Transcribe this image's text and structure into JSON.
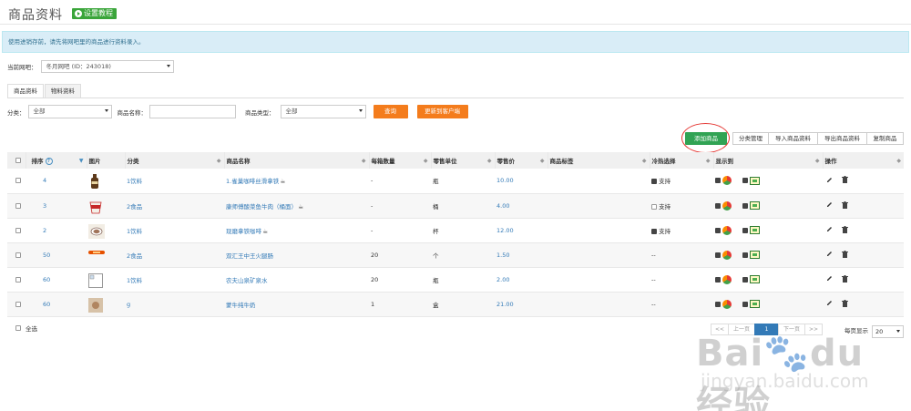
{
  "header": {
    "title": "商品资料",
    "tutorial_label": "设置教程"
  },
  "notice": "使用进销存前，请先将网吧里的商品进行资料录入。",
  "shop": {
    "label": "当前网吧：",
    "value": "冬月网吧 (ID：243018)"
  },
  "tabs": [
    {
      "label": "商品资料",
      "active": true
    },
    {
      "label": "物料资料",
      "active": false
    }
  ],
  "filters": {
    "category_label": "分类：",
    "category_value": "全部",
    "name_label": "商品名称：",
    "name_value": "",
    "type_label": "商品类型：",
    "type_value": "全部",
    "query_label": "查询",
    "sync_label": "更新到客户端"
  },
  "actions": {
    "add": "添加商品",
    "category_manage": "分类管理",
    "import": "导入商品资料",
    "export": "导出商品资料",
    "copy": "复制商品"
  },
  "columns": [
    "排序",
    "图片",
    "分类",
    "商品名称",
    "每箱数量",
    "零售单位",
    "零售价",
    "商品标签",
    "冷热选择",
    "显示到",
    "操作"
  ],
  "rows": [
    {
      "sort": "4",
      "category": "1饮料",
      "name": "1.雀巢咖啡丝滑拿铁",
      "box_qty": "-",
      "unit": "瓶",
      "price": "10.00",
      "hot_cold": "支持",
      "hot_cold_checked": true,
      "cup": true,
      "pic": "bottle"
    },
    {
      "sort": "3",
      "category": "2食品",
      "name": "康师傅酸菜鱼牛肉（桶面）",
      "box_qty": "-",
      "unit": "桶",
      "price": "4.00",
      "hot_cold": "支持",
      "hot_cold_checked": false,
      "cup": true,
      "pic": "noodle"
    },
    {
      "sort": "2",
      "category": "1饮料",
      "name": "现磨拿铁咖啡",
      "box_qty": "-",
      "unit": "杯",
      "price": "12.00",
      "hot_cold": "支持",
      "hot_cold_checked": true,
      "cup": true,
      "pic": "coffee"
    },
    {
      "sort": "50",
      "category": "2食品",
      "name": "双汇王中王火腿肠",
      "box_qty": "20",
      "unit": "个",
      "price": "1.50",
      "hot_cold": "--",
      "hot_cold_checked": null,
      "cup": false,
      "pic": "sausage"
    },
    {
      "sort": "60",
      "category": "1饮料",
      "name": "农夫山泉矿泉水",
      "box_qty": "20",
      "unit": "瓶",
      "price": "2.00",
      "hot_cold": "--",
      "hot_cold_checked": null,
      "cup": false,
      "pic": "broken"
    },
    {
      "sort": "60",
      "category": "g",
      "name": "蒙牛纯牛奶",
      "box_qty": "1",
      "unit": "盒",
      "price": "21.00",
      "hot_cold": "--",
      "hot_cold_checked": null,
      "cup": false,
      "pic": "milk"
    }
  ],
  "footer": {
    "select_all": "全选",
    "pager": [
      "<<",
      "上一页",
      "1",
      "下一页",
      ">>"
    ],
    "per_page_label": "每页显示",
    "per_page_value": "20"
  },
  "watermark": {
    "logo": "Bai du 经验",
    "sub": "jingyan.baidu.com"
  }
}
